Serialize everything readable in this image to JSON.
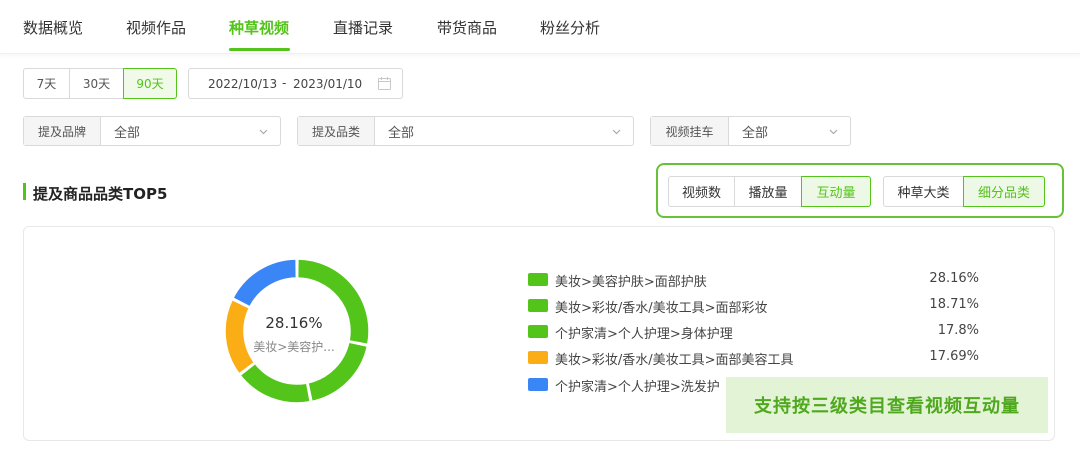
{
  "tabs": [
    {
      "label": "数据概览",
      "active": false
    },
    {
      "label": "视频作品",
      "active": false
    },
    {
      "label": "种草视频",
      "active": true
    },
    {
      "label": "直播记录",
      "active": false
    },
    {
      "label": "带货商品",
      "active": false
    },
    {
      "label": "粉丝分析",
      "active": false
    }
  ],
  "date_range": {
    "options": [
      "7天",
      "30天",
      "90天"
    ],
    "selected": "90天",
    "start": "2022/10/13",
    "separator": "-",
    "end": "2023/01/10",
    "icon": "calendar-icon"
  },
  "filters": [
    {
      "label": "提及品牌",
      "value": "全部"
    },
    {
      "label": "提及品类",
      "value": "全部"
    },
    {
      "label": "视频挂车",
      "value": "全部"
    }
  ],
  "section": {
    "title": "提及商品品类TOP5"
  },
  "metric_toggle": {
    "options": [
      "视频数",
      "播放量",
      "互动量"
    ],
    "selected": "互动量"
  },
  "level_toggle": {
    "options": [
      "种草大类",
      "细分品类"
    ],
    "selected": "细分品类"
  },
  "colors": {
    "accent": "#52c41a",
    "green": "#52c41a",
    "orange": "#faad14",
    "blue": "#3a86f7"
  },
  "chart_data": {
    "type": "pie",
    "center": {
      "value": "28.16%",
      "label": "美妆>美容护..."
    },
    "slices": [
      {
        "name": "美妆>美容护肤>面部护肤",
        "value": 28.16,
        "display": "28.16%",
        "color": "#52c41a"
      },
      {
        "name": "美妆>彩妆/香水/美妆工具>面部彩妆",
        "value": 18.71,
        "display": "18.71%",
        "color": "#52c41a"
      },
      {
        "name": "个护家清>个人护理>身体护理",
        "value": 17.8,
        "display": "17.8%",
        "color": "#52c41a"
      },
      {
        "name": "美妆>彩妆/香水/美妆工具>面部美容工具",
        "value": 17.69,
        "display": "17.69%",
        "color": "#faad14"
      },
      {
        "name": "个护家清>个人护理>洗发护",
        "value": 17.64,
        "display": "",
        "color": "#3a86f7"
      }
    ]
  },
  "banner": {
    "text": "支持按三级类目查看视频互动量"
  }
}
